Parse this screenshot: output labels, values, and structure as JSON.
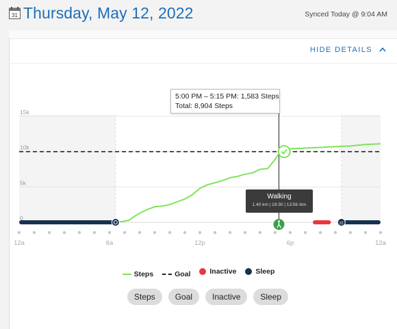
{
  "header": {
    "calendar_icon": "calendar-icon",
    "calendar_day": "31",
    "date_title": "Thursday, May 12, 2022",
    "synced_text": "Synced Today @ 9:04 AM"
  },
  "details_toggle": {
    "label": "HIDE DETAILS",
    "icon": "chevron-up-icon"
  },
  "tooltip_top": {
    "line1": "5:00 PM – 5:15 PM: 1,583 Steps",
    "line2": "Total: 8,904 Steps"
  },
  "tooltip_walking": {
    "title": "Walking",
    "detail": "1.40 km | 19:30 | 13:56 /km"
  },
  "chart_data": {
    "type": "area",
    "title": "",
    "xlabel": "",
    "ylabel": "",
    "y_ticks": [
      "15k",
      "10k",
      "5k",
      "0"
    ],
    "x_ticks": [
      "12a",
      "6a",
      "12p",
      "6p",
      "12a"
    ],
    "ylim": [
      0,
      15000
    ],
    "xlim_hours": [
      0,
      24
    ],
    "grid": true,
    "goal": 10000,
    "goal_reached_hour": 17.6,
    "cursor_hour": 17.25,
    "steps_series": {
      "name": "Steps",
      "color": "#7ee35a",
      "x_hours": [
        0,
        6.3,
        6.7,
        7.3,
        7.7,
        8.0,
        8.5,
        9.0,
        9.5,
        10.0,
        10.5,
        11.0,
        11.5,
        12.0,
        12.5,
        13.0,
        13.5,
        14.0,
        14.5,
        15.0,
        15.5,
        16.0,
        16.5,
        17.0,
        17.3,
        17.6,
        18.0,
        19.0,
        20.0,
        21.0,
        22.0,
        23.0,
        24.0
      ],
      "y_cumulative": [
        0,
        0,
        50,
        300,
        900,
        1300,
        1800,
        2200,
        2300,
        2500,
        2900,
        3300,
        3900,
        4800,
        5300,
        5600,
        5900,
        6300,
        6500,
        6800,
        7000,
        7500,
        7600,
        8900,
        9900,
        10200,
        10400,
        10500,
        10600,
        10700,
        10800,
        11000,
        11100
      ]
    },
    "sleep_segments_hours": [
      [
        0,
        6.4
      ],
      [
        21.4,
        24
      ]
    ],
    "inactive_segments_hours": [
      [
        19.5,
        20.7
      ]
    ],
    "sleep_shade_hours": [
      [
        0,
        6.4
      ],
      [
        21.4,
        24
      ]
    ],
    "legend": [
      {
        "label": "Steps",
        "marker": "line",
        "color": "#7ee35a"
      },
      {
        "label": "Goal",
        "marker": "dash",
        "color": "#222222"
      },
      {
        "label": "Inactive",
        "marker": "dot",
        "color": "#e8383e"
      },
      {
        "label": "Sleep",
        "marker": "dot",
        "color": "#16324f"
      }
    ]
  },
  "filters": [
    "Steps",
    "Goal",
    "Inactive",
    "Sleep"
  ]
}
